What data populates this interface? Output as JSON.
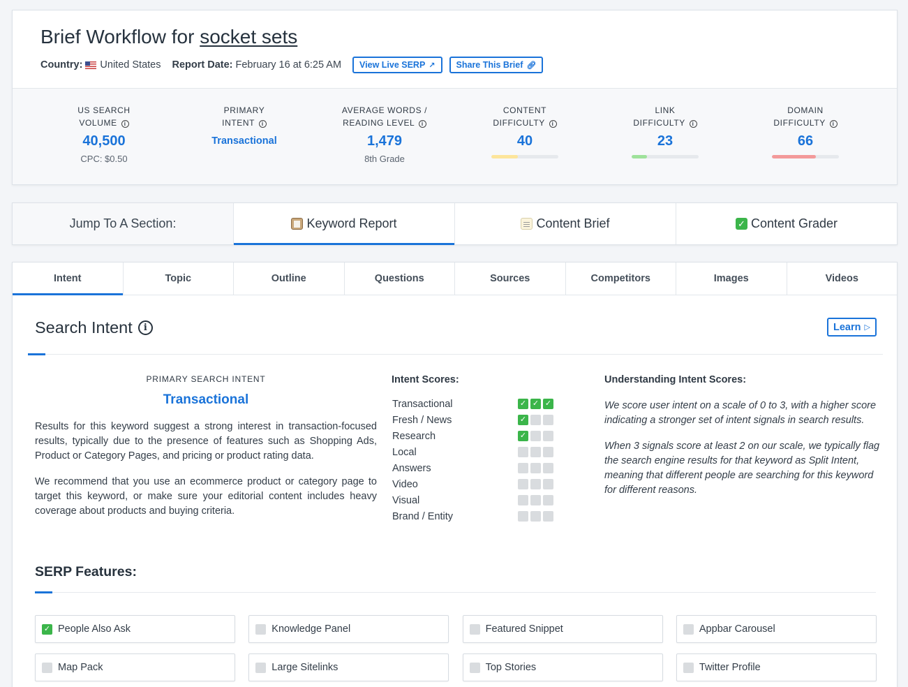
{
  "header": {
    "title_prefix": "Brief Workflow for ",
    "keyword": "socket sets",
    "country_label": "Country:",
    "country_value": "United States",
    "report_date_label": "Report Date:",
    "report_date_value": "February 16 at 6:25 AM",
    "view_serp_label": "View Live SERP",
    "share_label": "Share This Brief"
  },
  "stats": [
    {
      "label1": "US SEARCH",
      "label2": "VOLUME",
      "value": "40,500",
      "sub": "CPC: $0.50"
    },
    {
      "label1": "PRIMARY",
      "label2": "INTENT",
      "value": "Transactional"
    },
    {
      "label1": "AVERAGE WORDS /",
      "label2": "READING LEVEL",
      "value": "1,479",
      "sub": "8th Grade"
    },
    {
      "label1": "CONTENT",
      "label2": "DIFFICULTY",
      "value": "40",
      "bar": 0.4,
      "bar_color": "#fde59b"
    },
    {
      "label1": "LINK",
      "label2": "DIFFICULTY",
      "value": "23",
      "bar": 0.23,
      "bar_color": "#9fe29b"
    },
    {
      "label1": "DOMAIN",
      "label2": "DIFFICULTY",
      "value": "66",
      "bar": 0.66,
      "bar_color": "#f39a9a"
    }
  ],
  "jump": {
    "label": "Jump To A Section:",
    "items": [
      "Keyword Report",
      "Content Brief",
      "Content Grader"
    ]
  },
  "tabs": [
    "Intent",
    "Topic",
    "Outline",
    "Questions",
    "Sources",
    "Competitors",
    "Images",
    "Videos"
  ],
  "search_intent": {
    "title": "Search Intent",
    "learn_label": "Learn",
    "primary_label": "PRIMARY SEARCH INTENT",
    "primary_value": "Transactional",
    "para1": "Results for this keyword suggest a strong interest in transaction-focused results, typically due to the presence of features such as Shopping Ads, Product or Category Pages, and pricing or product rating data.",
    "para2": "We recommend that you use an ecommerce product or category page to target this keyword, or make sure your editorial content includes heavy coverage about products and buying criteria.",
    "scores_title": "Intent Scores:",
    "scores": [
      {
        "name": "Transactional",
        "score": 3
      },
      {
        "name": "Fresh / News",
        "score": 1
      },
      {
        "name": "Research",
        "score": 1
      },
      {
        "name": "Local",
        "score": 0
      },
      {
        "name": "Answers",
        "score": 0
      },
      {
        "name": "Video",
        "score": 0
      },
      {
        "name": "Visual",
        "score": 0
      },
      {
        "name": "Brand / Entity",
        "score": 0
      }
    ],
    "understanding_title": "Understanding Intent Scores:",
    "understanding_p1": "We score user intent on a scale of 0 to 3, with a higher score indicating a stronger set of intent signals in search results.",
    "understanding_p2": "When 3 signals score at least 2 on our scale, we typically flag the search engine results for that keyword as Split Intent, meaning that different people are searching for this keyword for different reasons."
  },
  "serp": {
    "title": "SERP Features:",
    "features": [
      {
        "name": "People Also Ask",
        "checked": true
      },
      {
        "name": "Knowledge Panel",
        "checked": false
      },
      {
        "name": "Featured Snippet",
        "checked": false
      },
      {
        "name": "Appbar Carousel",
        "checked": false
      },
      {
        "name": "Map Pack",
        "checked": false
      },
      {
        "name": "Large Sitelinks",
        "checked": false
      },
      {
        "name": "Top Stories",
        "checked": false
      },
      {
        "name": "Twitter Profile",
        "checked": false
      }
    ]
  },
  "colors": {
    "accent": "#1a73d9",
    "check": "#3bb54a",
    "empty": "#d9dcdf"
  }
}
